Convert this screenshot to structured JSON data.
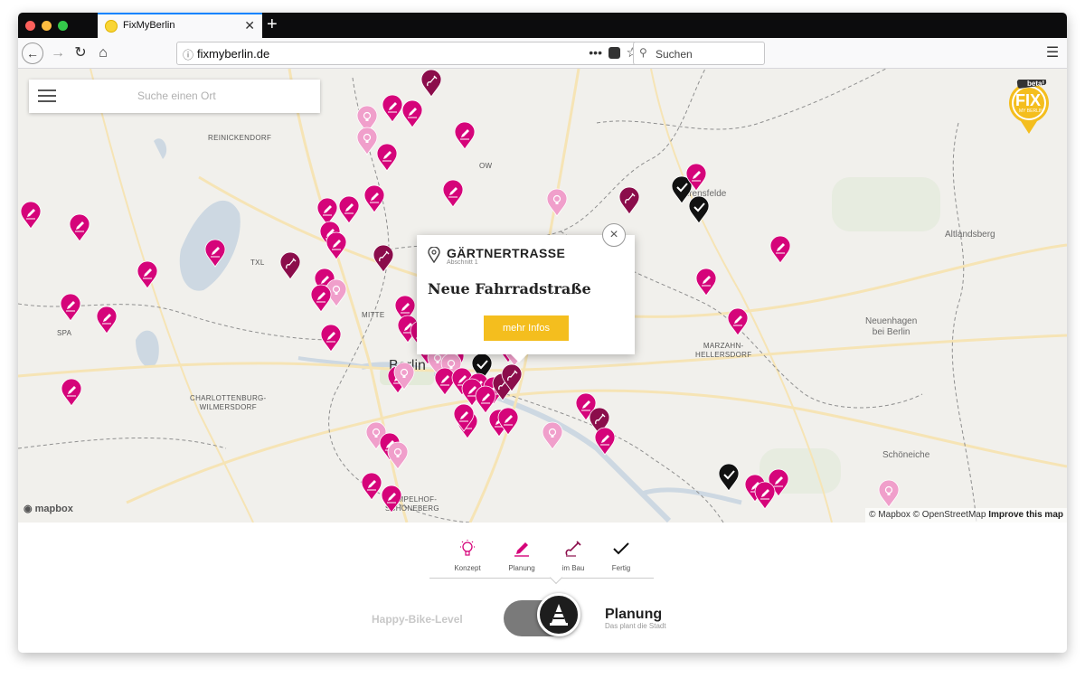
{
  "browser": {
    "tab_title": "FixMyBerlin",
    "url": "fixmyberlin.de",
    "search_placeholder": "Suchen",
    "traffic_colors": [
      "#fc605b",
      "#fdbc40",
      "#34c84a"
    ]
  },
  "app": {
    "search_placeholder": "Suche einen Ort",
    "logo_text": "FIX",
    "logo_sub": "MY BERLIN",
    "beta_label": "beta!",
    "accent": "#f4be1e"
  },
  "map": {
    "labels": {
      "reinickendorf": "REINICKENDORF",
      "txl": "TXL",
      "mitte": "MITTE",
      "berlin": "Berlin",
      "spandau": "SPA",
      "charlottenburg": "CHARLOTTENBURG-\nWILMERSDORF",
      "tempelhof": "TEMPELHOF-\nSCHÖNEBERG",
      "marzahn": "MARZAHN-\nHELLERSDORF",
      "ahrensfelde": "Ahrensfelde",
      "altlandsberg": "Altlandsberg",
      "neuenhagen": "Neuenhagen\nbei Berlin",
      "schoeneiche": "Schöneiche",
      "pankow_frag": "OW"
    },
    "mapbox_logo": "mapbox",
    "attribution_a": "© Mapbox © OpenStreetMap",
    "attribution_b": "Improve this map",
    "colors": {
      "planung": "#d5047a",
      "konzept": "#f09fcb",
      "im_bau": "#8b0d4b",
      "fertig": "#111111"
    }
  },
  "popup": {
    "title": "GÄRTNERTRASSE",
    "subtitle": "Abschnitt 1",
    "headline": "Neue Fahrradstraße",
    "button": "mehr Infos",
    "close": "×"
  },
  "legend": {
    "items": [
      {
        "label": "Konzept"
      },
      {
        "label": "Planung"
      },
      {
        "label": "im Bau"
      },
      {
        "label": "Fertig"
      }
    ]
  },
  "level": {
    "label": "Happy-Bike-Level",
    "title": "Planung",
    "subtitle": "Das plant die Stadt"
  }
}
